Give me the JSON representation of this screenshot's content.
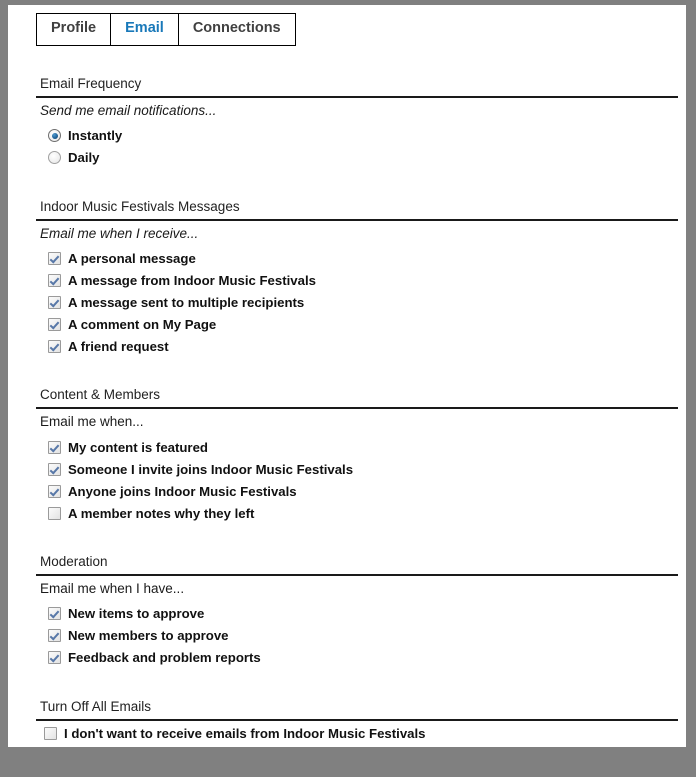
{
  "tabs": [
    {
      "label": "Profile",
      "active": false
    },
    {
      "label": "Email",
      "active": true
    },
    {
      "label": "Connections",
      "active": false
    }
  ],
  "sections": [
    {
      "title": "Email Frequency",
      "subtitle": "Send me email notifications...",
      "subtitle_italic": true,
      "control_type": "radio",
      "options": [
        {
          "label": "Instantly",
          "checked": true
        },
        {
          "label": "Daily",
          "checked": false
        }
      ]
    },
    {
      "title": "Indoor Music Festivals Messages",
      "subtitle": "Email me when I receive...",
      "subtitle_italic": true,
      "control_type": "checkbox",
      "options": [
        {
          "label": "A personal message",
          "checked": true
        },
        {
          "label": "A message from Indoor Music Festivals",
          "checked": true
        },
        {
          "label": "A message sent to multiple recipients",
          "checked": true
        },
        {
          "label": "A comment on My Page",
          "checked": true
        },
        {
          "label": "A friend request",
          "checked": true
        }
      ]
    },
    {
      "title": "Content & Members",
      "subtitle": "Email me when...",
      "subtitle_italic": false,
      "control_type": "checkbox",
      "options": [
        {
          "label": "My content is featured",
          "checked": true
        },
        {
          "label": "Someone I invite joins Indoor Music Festivals",
          "checked": true
        },
        {
          "label": "Anyone joins Indoor Music Festivals",
          "checked": true
        },
        {
          "label": "A member notes why they left",
          "checked": false
        }
      ]
    },
    {
      "title": "Moderation",
      "subtitle": "Email me when I have...",
      "subtitle_italic": false,
      "control_type": "checkbox",
      "options": [
        {
          "label": "New items to approve",
          "checked": true
        },
        {
          "label": "New members to approve",
          "checked": true
        },
        {
          "label": "Feedback and problem reports",
          "checked": true
        }
      ]
    },
    {
      "title": "Turn Off All Emails",
      "subtitle": null,
      "subtitle_italic": false,
      "control_type": "checkbox",
      "flush": true,
      "options": [
        {
          "label": "I don't want to receive emails from Indoor Music Festivals",
          "checked": false
        }
      ]
    }
  ],
  "colors": {
    "active_tab": "#1878b9",
    "tab_text": "#404040",
    "page_background": "#ffffff",
    "outer_background": "#808080",
    "rule": "#1a1a1a",
    "check_mark": "#5878a8",
    "radio_dot": "#1c5e94"
  }
}
